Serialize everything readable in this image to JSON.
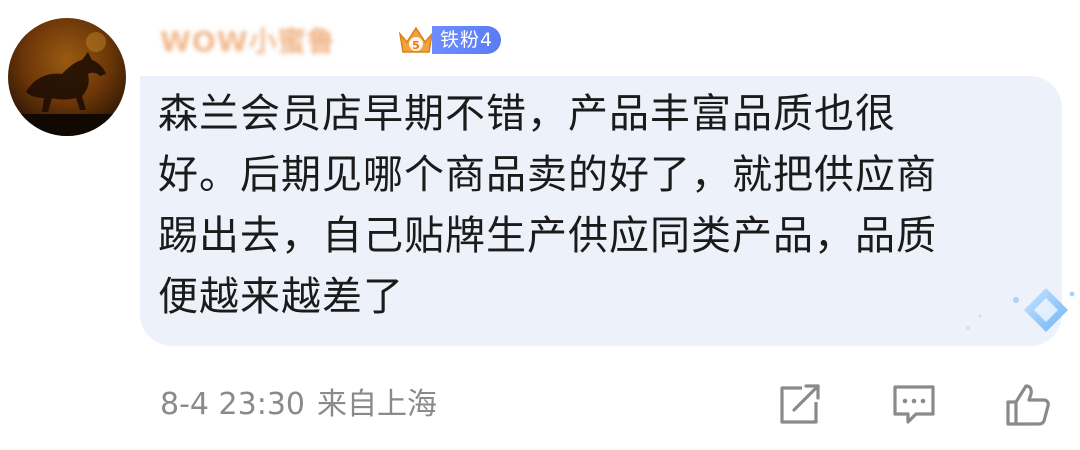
{
  "comment": {
    "author_name": "WOW小蜜鲁",
    "badge": {
      "level": "5",
      "label": "铁粉4"
    },
    "content_lines": [
      "森兰会员店早期不错，产品丰富品质也很",
      "好。后期见哪个商品卖的好了，就把供应商",
      "踢出去，自己贴牌生产供应同类产品，品质",
      "便越来越差了"
    ],
    "timestamp": "8-4 23:30",
    "location": "来自上海"
  },
  "icons": {
    "share": "share-icon",
    "reply": "comment-icon",
    "like": "thumbs-up-icon",
    "badge": "crown-fan-icon",
    "avatar": "horse-avatar",
    "decoration": "diamond-sparkle-icon"
  },
  "colors": {
    "bubble_bg": "#edf2fa",
    "meta_text": "#8a8a8a",
    "body_text": "#1b1b1b",
    "badge_blue": "#5a7cf4",
    "badge_gold": "#f2a23a"
  }
}
